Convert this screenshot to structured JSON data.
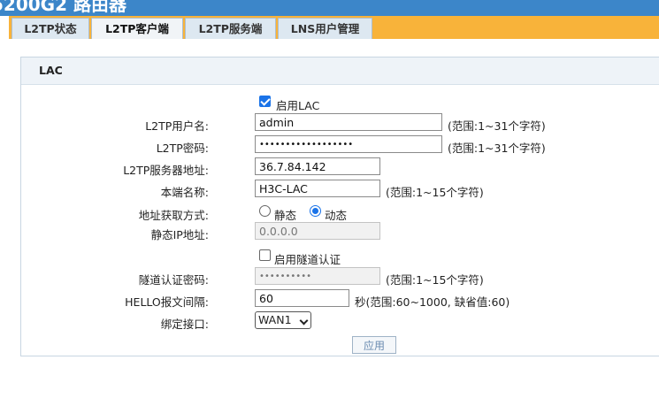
{
  "window": {
    "title_fragment": "5200G2 路由器"
  },
  "tabs": [
    {
      "label": "L2TP状态",
      "active": false
    },
    {
      "label": "L2TP客户端",
      "active": true
    },
    {
      "label": "L2TP服务端",
      "active": false
    },
    {
      "label": "LNS用户管理",
      "active": false
    }
  ],
  "panel": {
    "title": "LAC"
  },
  "form": {
    "enable_lac": {
      "label": "启用LAC",
      "checked": true
    },
    "username": {
      "label": "L2TP用户名:",
      "value": "admin",
      "hint": "(范围:1~31个字符)"
    },
    "password": {
      "label": "L2TP密码:",
      "value": "••••••••••••••••••",
      "hint": "(范围:1~31个字符)"
    },
    "server": {
      "label": "L2TP服务器地址:",
      "value": "36.7.84.142"
    },
    "local_name": {
      "label": "本端名称:",
      "value": "H3C-LAC",
      "hint": "(范围:1~15个字符)"
    },
    "addr_mode": {
      "label": "地址获取方式:",
      "static_label": "静态",
      "dynamic_label": "动态",
      "selected": "dynamic"
    },
    "static_ip": {
      "label": "静态IP地址:",
      "value": "0.0.0.0",
      "disabled": true
    },
    "tunnel_auth": {
      "label": "启用隧道认证",
      "checked": false
    },
    "tunnel_pwd": {
      "label": "隧道认证密码:",
      "value": "••••••••••",
      "hint": "(范围:1~15个字符)",
      "disabled": true
    },
    "hello": {
      "label": "HELLO报文间隔:",
      "value": "60",
      "hint": "秒(范围:60~1000, 缺省值:60)"
    },
    "bind_if": {
      "label": "绑定接口:",
      "value": "WAN1"
    },
    "apply_label": "应用"
  },
  "colors": {
    "header_blue": "#3c86c9",
    "tab_strip_orange": "#f8b33a",
    "accent": "#1a73e8"
  }
}
